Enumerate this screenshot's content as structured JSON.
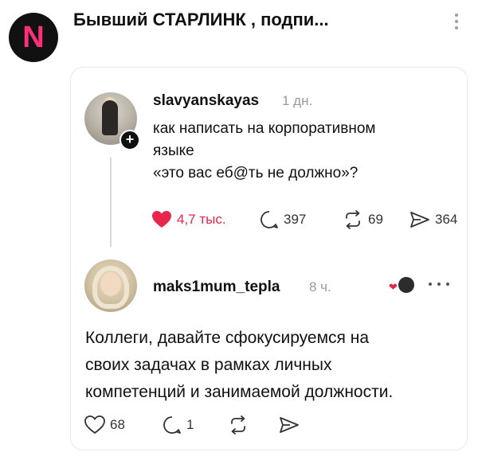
{
  "header": {
    "avatar_letter": "N",
    "title": "Бывший СТАРЛИНК , подпи..."
  },
  "post1": {
    "username": "slavyanskayas",
    "time": "1 дн.",
    "text_lines": [
      "как написать на корпоративном",
      "языке",
      "«это вас еб@ть не должно»?"
    ],
    "likes": "4,7 тыс.",
    "replies": "397",
    "reposts": "69",
    "shares": "364"
  },
  "post2": {
    "username": "maks1mum_tepla",
    "time": "8 ч.",
    "text_lines": [
      "Коллеги, давайте сфокусируемся на",
      "своих задачах в рамках личных",
      "компетенций и занимаемой должности."
    ],
    "likes": "68",
    "replies": "1"
  },
  "colors": {
    "like_red": "#e8264b",
    "avatar_letter": "#ff2f7a"
  },
  "icons": [
    "more-vertical-icon",
    "plus-icon",
    "heart-icon",
    "comment-icon",
    "repost-icon",
    "share-icon",
    "more-horizontal-icon"
  ]
}
